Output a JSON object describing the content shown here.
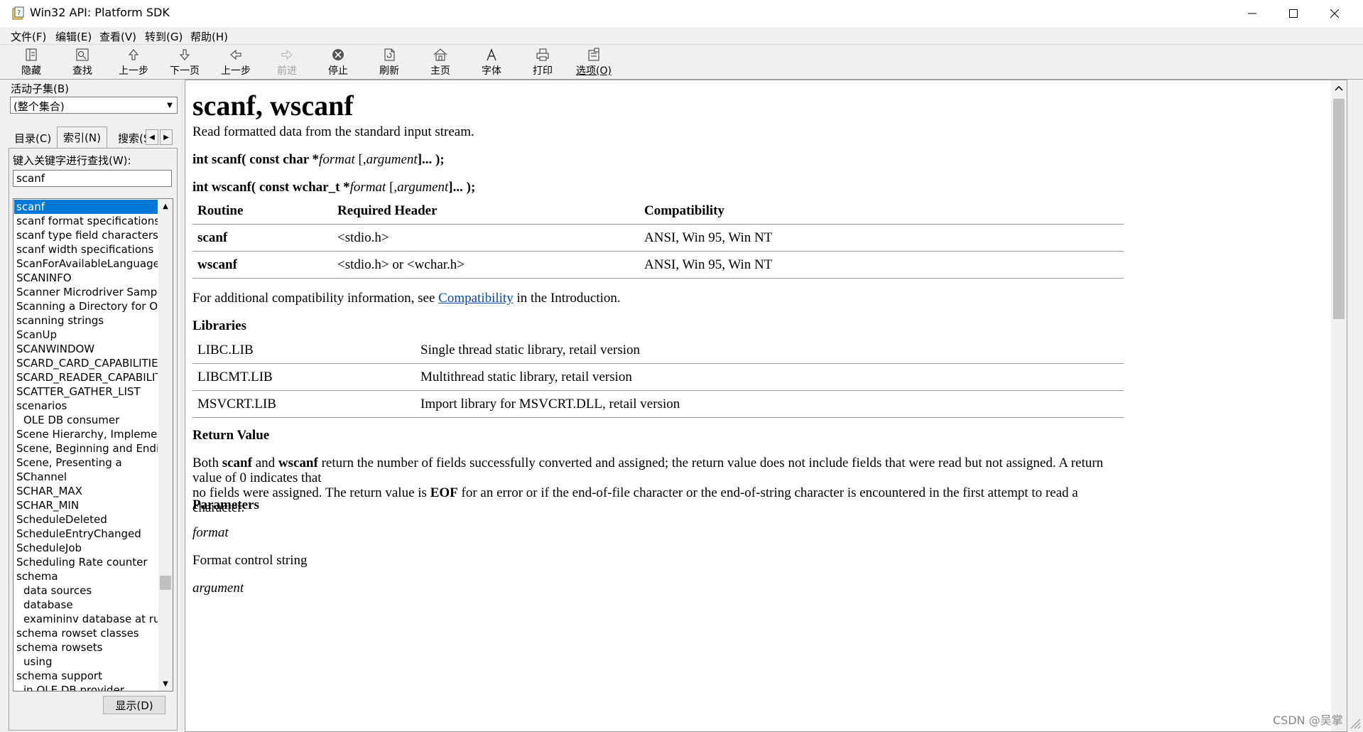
{
  "window": {
    "title": "Win32 API: Platform SDK"
  },
  "menubar": {
    "items": [
      "文件(F)",
      "编辑(E)",
      "查看(V)",
      "转到(G)",
      "帮助(H)"
    ]
  },
  "toolbar": {
    "buttons": [
      {
        "label": "隐藏",
        "icon": "hide-icon"
      },
      {
        "label": "查找",
        "icon": "find-icon"
      },
      {
        "label": "上一步",
        "icon": "up-arrow-icon"
      },
      {
        "label": "下一页",
        "icon": "down-arrow-icon"
      },
      {
        "label": "上一步",
        "icon": "back-arrow-icon"
      },
      {
        "label": "前进",
        "icon": "forward-arrow-icon",
        "disabled": true
      },
      {
        "label": "停止",
        "icon": "stop-icon"
      },
      {
        "label": "刷新",
        "icon": "refresh-icon"
      },
      {
        "label": "主页",
        "icon": "home-icon"
      },
      {
        "label": "字体",
        "icon": "font-icon"
      },
      {
        "label": "打印",
        "icon": "print-icon"
      },
      {
        "label": "选项(O)",
        "icon": "options-icon"
      }
    ]
  },
  "left": {
    "subset_label": "活动子集(B)",
    "subset_value": "(整个集合)",
    "tabs": {
      "contents": "目录(C)",
      "index": "索引(N)",
      "search": "搜索(S"
    },
    "keyword_label": "键入关键字进行查找(W):",
    "keyword_value": "scanf",
    "display_button": "显示(D)",
    "index_items": [
      {
        "text": "scanf",
        "selected": true
      },
      {
        "text": "scanf format specifications"
      },
      {
        "text": "scanf type field characters"
      },
      {
        "text": "scanf width specifications"
      },
      {
        "text": "ScanForAvailableLanguages"
      },
      {
        "text": "SCANINFO"
      },
      {
        "text": "Scanner Microdriver Sample"
      },
      {
        "text": "Scanning a Directory for Ob"
      },
      {
        "text": "scanning strings"
      },
      {
        "text": "ScanUp"
      },
      {
        "text": "SCANWINDOW"
      },
      {
        "text": "SCARD_CARD_CAPABILITIES"
      },
      {
        "text": "SCARD_READER_CAPABILITI"
      },
      {
        "text": "SCATTER_GATHER_LIST"
      },
      {
        "text": "scenarios"
      },
      {
        "text": "OLE DB consumer",
        "sub": true
      },
      {
        "text": "Scene Hierarchy, Implemen"
      },
      {
        "text": "Scene, Beginning and Endir"
      },
      {
        "text": "Scene, Presenting a"
      },
      {
        "text": "SChannel"
      },
      {
        "text": "SCHAR_MAX"
      },
      {
        "text": "SCHAR_MIN"
      },
      {
        "text": "ScheduleDeleted"
      },
      {
        "text": "ScheduleEntryChanged"
      },
      {
        "text": "ScheduleJob"
      },
      {
        "text": "Scheduling Rate counter"
      },
      {
        "text": "schema"
      },
      {
        "text": "data sources",
        "sub": true
      },
      {
        "text": "database",
        "sub": true
      },
      {
        "text": "examininv database at run",
        "sub": true
      },
      {
        "text": "schema rowset classes"
      },
      {
        "text": "schema rowsets"
      },
      {
        "text": "using",
        "sub": true
      },
      {
        "text": "schema support"
      },
      {
        "text": "in OLE DB provider",
        "sub": true
      }
    ]
  },
  "doc": {
    "title": "scanf, wscanf",
    "intro": "Read formatted data from the standard input stream.",
    "sig1": {
      "pre": "int scanf( const char *",
      "arg": "format",
      "mid": " [,",
      "arg2": "argument",
      "post": "]... );"
    },
    "sig2": {
      "pre": "int wscanf( const wchar_t *",
      "arg": "format",
      "mid": " [,",
      "arg2": "argument",
      "post": "]... );"
    },
    "compat_table": {
      "headers": [
        "Routine",
        "Required Header",
        "Compatibility"
      ],
      "rows": [
        [
          "scanf",
          "<stdio.h>",
          "ANSI, Win 95, Win NT"
        ],
        [
          "wscanf",
          "<stdio.h> or <wchar.h>",
          "ANSI, Win 95, Win NT"
        ]
      ]
    },
    "compat_note": {
      "pre": "For additional compatibility information, see ",
      "link": "Compatibility",
      "post": " in the Introduction."
    },
    "libraries_heading": "Libraries",
    "lib_table": [
      [
        "LIBC.LIB",
        "Single thread static library, retail version"
      ],
      [
        "LIBCMT.LIB",
        "Multithread static library, retail version"
      ],
      [
        "MSVCRT.LIB",
        "Import library for MSVCRT.DLL, retail version"
      ]
    ],
    "return_heading": "Return Value",
    "return_text": {
      "a": "Both ",
      "b": "scanf",
      "c": " and ",
      "d": "wscanf",
      "e": " return the number of fields successfully converted and assigned; the return value does not include fields that were read but not assigned. A return value of 0 indicates that",
      "f": "no fields were assigned. The return value is ",
      "g": "EOF",
      "h": " for an error or if the end-of-file character or the end-of-string character is encountered in the first attempt to read a character."
    },
    "params_heading": "Parameters",
    "param1_name": "format",
    "param1_desc": "Format control string",
    "param2_name": "argument"
  },
  "watermark": "CSDN @吴掌"
}
